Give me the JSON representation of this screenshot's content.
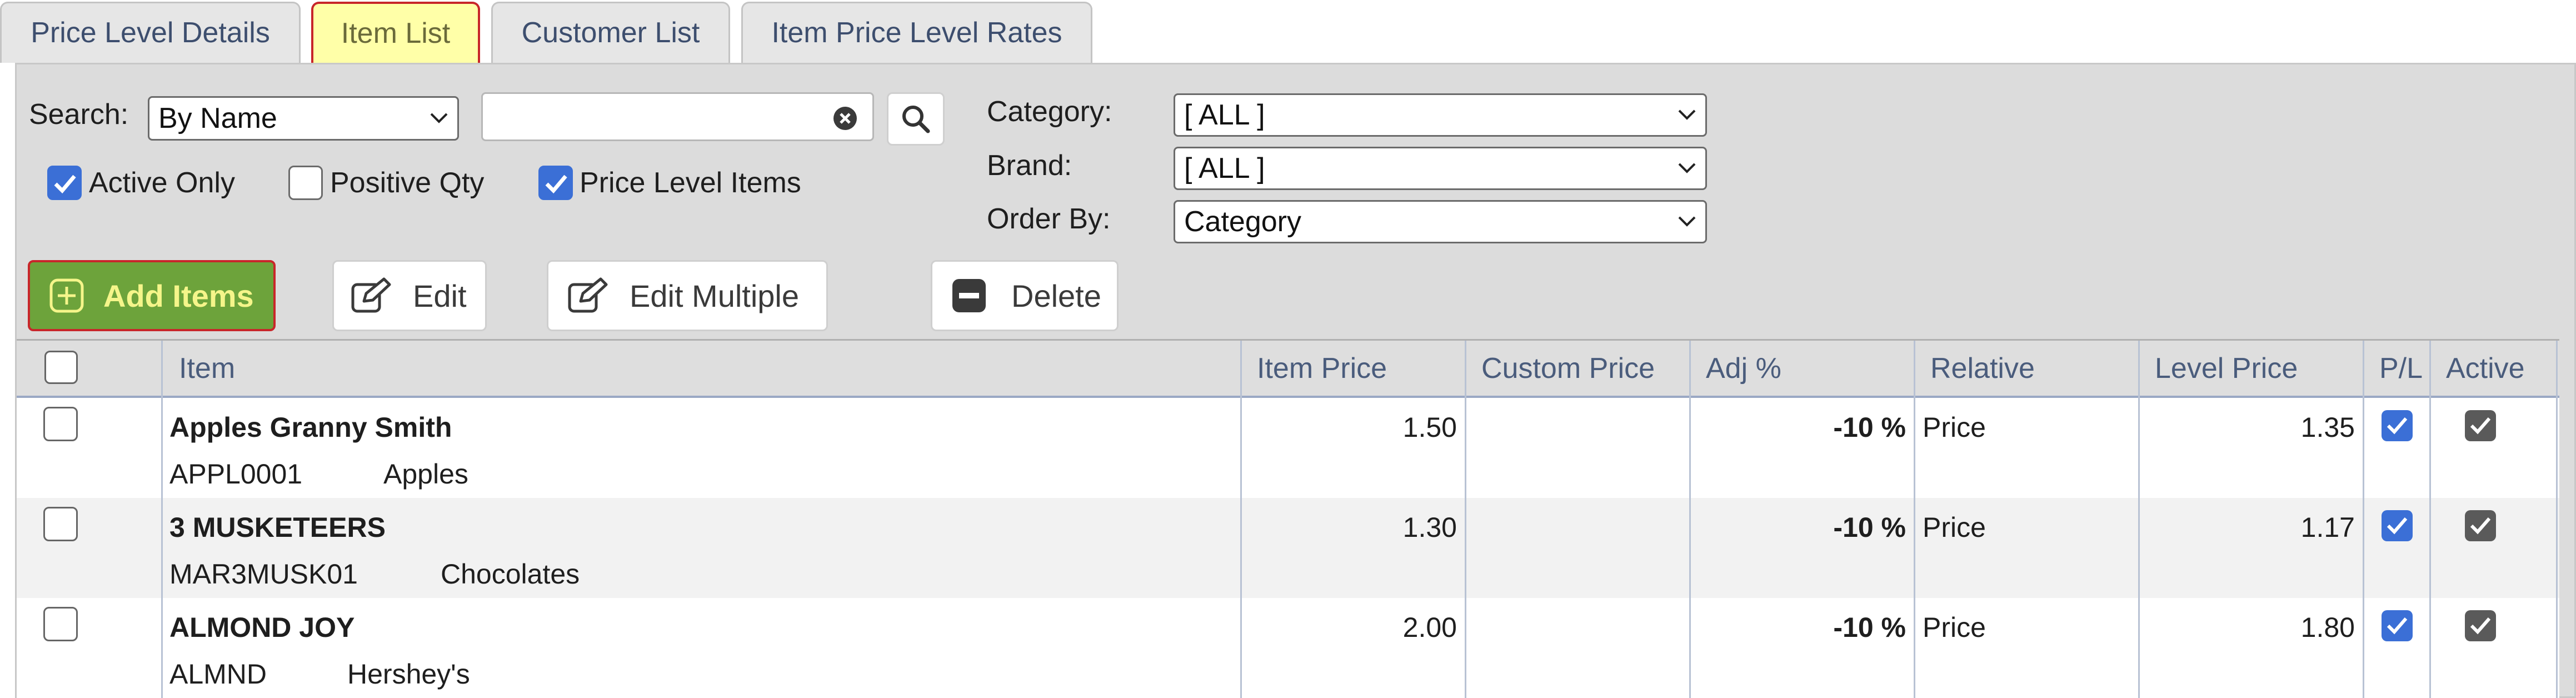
{
  "tabs": [
    {
      "label": "Price Level Details",
      "active": false
    },
    {
      "label": "Item List",
      "active": true
    },
    {
      "label": "Customer List",
      "active": false
    },
    {
      "label": "Item Price Level Rates",
      "active": false
    }
  ],
  "filters": {
    "search_label": "Search:",
    "search_mode": "By Name",
    "search_value": "",
    "category_label": "Category:",
    "category_value": "[ ALL ]",
    "brand_label": "Brand:",
    "brand_value": "[ ALL ]",
    "order_by_label": "Order By:",
    "order_by_value": "Category",
    "active_only_label": "Active Only",
    "active_only_checked": true,
    "positive_qty_label": "Positive Qty",
    "positive_qty_checked": false,
    "price_level_items_label": "Price Level Items",
    "price_level_items_checked": true
  },
  "toolbar": {
    "add_items_label": "Add Items",
    "edit_label": "Edit",
    "edit_multiple_label": "Edit Multiple",
    "delete_label": "Delete"
  },
  "table": {
    "columns": [
      "Item",
      "Item Price",
      "Custom Price",
      "Adj %",
      "Relative",
      "Level Price",
      "P/L",
      "Active"
    ],
    "rows": [
      {
        "name": "Apples Granny Smith",
        "code": "APPL0001",
        "category": "Apples",
        "item_price": "1.50",
        "custom_price": "",
        "adj": "-10 %",
        "relative": "Price",
        "level_price": "1.35",
        "pl": true,
        "active": true
      },
      {
        "name": "3 MUSKETEERS",
        "code": "MAR3MUSK01",
        "category": "Chocolates",
        "item_price": "1.30",
        "custom_price": "",
        "adj": "-10 %",
        "relative": "Price",
        "level_price": "1.17",
        "pl": true,
        "active": true
      },
      {
        "name": "ALMOND JOY",
        "code": "ALMND",
        "category": "Hershey's",
        "item_price": "2.00",
        "custom_price": "",
        "adj": "-10 %",
        "relative": "Price",
        "level_price": "1.80",
        "pl": true,
        "active": true
      }
    ]
  },
  "colors": {
    "active_tab_bg": "#ffffa8",
    "active_tab_border": "#c8262a",
    "add_button_bg": "#6da33b",
    "add_button_text": "#f5f58a",
    "checkbox_blue": "#3b6fd6",
    "panel_bg": "#dcdcdc",
    "header_text": "#4a5c7c"
  },
  "icons": {
    "search": "search-icon",
    "clear": "clear-icon",
    "add": "plus-square-icon",
    "edit": "edit-icon",
    "delete": "minus-square-icon",
    "dropdown": "chevron-down-icon"
  }
}
